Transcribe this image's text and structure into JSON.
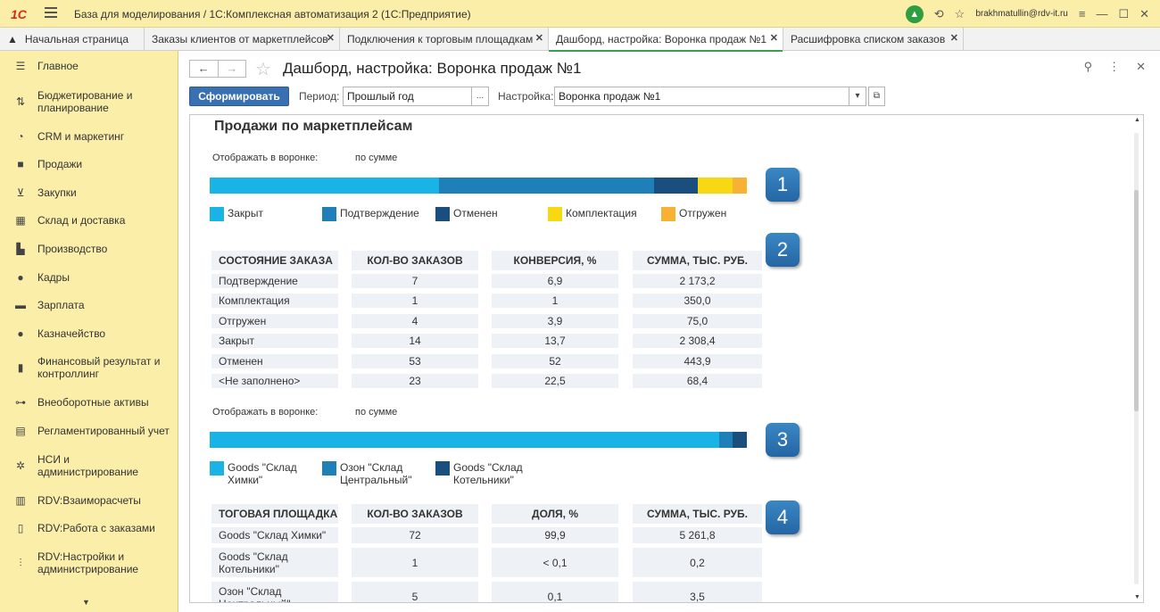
{
  "app": {
    "logo": "1С",
    "window_title": "База для моделирования / 1С:Комплексная автоматизация 2  (1С:Предприятие)",
    "user": "brakhmatullin@rdv-it.ru"
  },
  "tabs": [
    {
      "label": "Начальная страница",
      "icon": "home-icon",
      "closable": false
    },
    {
      "label": "Заказы клиентов от маркетплейсов",
      "closable": true
    },
    {
      "label": "Подключения к торговым площадкам",
      "closable": true
    },
    {
      "label": "Дашборд, настройка: Воронка продаж №1",
      "closable": true,
      "active": true
    },
    {
      "label": "Расшифровка списком заказов",
      "closable": true
    }
  ],
  "sidebar": {
    "items": [
      {
        "label": "Главное",
        "icon": "menu-icon"
      },
      {
        "label": "Бюджетирование и планирование",
        "icon": "budget-icon"
      },
      {
        "label": "CRM и маркетинг",
        "icon": "pie-icon"
      },
      {
        "label": "Продажи",
        "icon": "bag-icon"
      },
      {
        "label": "Закупки",
        "icon": "cart-icon"
      },
      {
        "label": "Склад и доставка",
        "icon": "warehouse-icon"
      },
      {
        "label": "Производство",
        "icon": "factory-icon"
      },
      {
        "label": "Кадры",
        "icon": "person-icon"
      },
      {
        "label": "Зарплата",
        "icon": "wallet-icon"
      },
      {
        "label": "Казначейство",
        "icon": "coin-icon"
      },
      {
        "label": "Финансовый результат и контроллинг",
        "icon": "bar-chart-icon"
      },
      {
        "label": "Внеоборотные активы",
        "icon": "car-icon"
      },
      {
        "label": "Регламентированный учет",
        "icon": "calculator-icon"
      },
      {
        "label": "НСИ и администрирование",
        "icon": "gear-icon"
      },
      {
        "label": "RDV:Взаиморасчеты",
        "icon": "rdv-calc-icon"
      },
      {
        "label": "RDV:Работа с заказами",
        "icon": "rdv-orders-icon"
      },
      {
        "label": "RDV:Настройки и администрирование",
        "icon": "rdv-settings-icon"
      }
    ]
  },
  "form": {
    "title": "Дашборд, настройка: Воронка продаж №1",
    "generate_label": "Сформировать",
    "period_label": "Период:",
    "period_value": "Прошлый год",
    "period_button": "...",
    "setting_label": "Настройка:",
    "setting_value": "Воронка продаж №1"
  },
  "report": {
    "title": "Продажи по маркетплейсам",
    "funnel1": {
      "mode_label": "Отображать в воронке:",
      "mode_value": "по сумме",
      "badge": "1",
      "legend": [
        {
          "label": "Закрыт",
          "color": "#1ab3e6"
        },
        {
          "label": "Подтверждение",
          "color": "#1f7fb9"
        },
        {
          "label": "Отменен",
          "color": "#1a4e7c"
        },
        {
          "label": "Комплектация",
          "color": "#f7d813"
        },
        {
          "label": "Отгружен",
          "color": "#f8b133"
        }
      ]
    },
    "table1": {
      "badge": "2",
      "headers": [
        "СОСТОЯНИЕ ЗАКАЗА",
        "КОЛ-ВО ЗАКАЗОВ",
        "КОНВЕРСИЯ, %",
        "СУММА, ТЫС. РУБ."
      ],
      "rows": [
        [
          "Подтверждение",
          "7",
          "6,9",
          "2 173,2"
        ],
        [
          "Комплектация",
          "1",
          "1",
          "350,0"
        ],
        [
          "Отгружен",
          "4",
          "3,9",
          "75,0"
        ],
        [
          "Закрыт",
          "14",
          "13,7",
          "2 308,4"
        ],
        [
          "Отменен",
          "53",
          "52",
          "443,9"
        ],
        [
          "<Не заполнено>",
          "23",
          "22,5",
          "68,4"
        ]
      ]
    },
    "funnel2": {
      "mode_label": "Отображать в воронке:",
      "mode_value": "по сумме",
      "badge": "3",
      "legend": [
        {
          "label": "Goods \"Склад Химки\"",
          "color": "#1ab3e6"
        },
        {
          "label": "Озон \"Склад Центральный\"",
          "color": "#1f7fb9"
        },
        {
          "label": "Goods \"Склад Котельники\"",
          "color": "#1a4e7c"
        }
      ]
    },
    "table2": {
      "badge": "4",
      "headers": [
        "ТОГОВАЯ ПЛОЩАДКА",
        "КОЛ-ВО ЗАКАЗОВ",
        "ДОЛЯ, %",
        "СУММА, ТЫС. РУБ."
      ],
      "rows": [
        [
          "Goods \"Склад Химки\"",
          "72",
          "99,9",
          "5 261,8"
        ],
        [
          "Goods \"Склад Котельники\"",
          "1",
          "< 0,1",
          "0,2"
        ],
        [
          "Озон \"Склад Центральный\"",
          "5",
          "0,1",
          "3,5"
        ]
      ]
    }
  },
  "chart_data": [
    {
      "type": "bar",
      "orientation": "horizontal-stacked",
      "categories": [
        "Закрыт",
        "Подтверждение",
        "Отменен",
        "Комплектация",
        "Отгружен"
      ],
      "values": [
        2308.4,
        2173.2,
        443.9,
        350.0,
        75.0
      ],
      "colors": [
        "#1ab3e6",
        "#1f7fb9",
        "#1a4e7c",
        "#f7d813",
        "#f8b133"
      ]
    },
    {
      "type": "bar",
      "orientation": "horizontal-stacked",
      "categories": [
        "Goods \"Склад Химки\"",
        "Озон \"Склад Центральный\"",
        "Goods \"Склад Котельники\""
      ],
      "values": [
        5261.8,
        3.5,
        0.2
      ],
      "colors": [
        "#1ab3e6",
        "#1f7fb9",
        "#1a4e7c"
      ]
    }
  ]
}
